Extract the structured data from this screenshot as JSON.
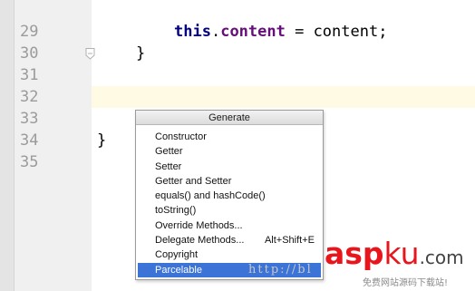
{
  "editor": {
    "line_numbers": [
      "29",
      "30",
      "31",
      "32",
      "33",
      "34",
      "35"
    ],
    "code_lines": [
      {
        "keyword": "this",
        "dot": ".",
        "field": "content",
        "rest": " = content;"
      },
      {
        "text": "}"
      },
      {
        "text": ""
      },
      {
        "text": ""
      },
      {
        "text": ""
      },
      {
        "text": "}"
      },
      {
        "text": ""
      }
    ],
    "current_line": "32"
  },
  "generate_popup": {
    "title": "Generate",
    "items": [
      {
        "label": "Constructor",
        "shortcut": ""
      },
      {
        "label": "Getter",
        "shortcut": ""
      },
      {
        "label": "Setter",
        "shortcut": ""
      },
      {
        "label": "Getter and Setter",
        "shortcut": ""
      },
      {
        "label": "equals() and hashCode()",
        "shortcut": ""
      },
      {
        "label": "toString()",
        "shortcut": ""
      },
      {
        "label": "Override Methods...",
        "shortcut": ""
      },
      {
        "label": "Delegate Methods...",
        "shortcut": "Alt+Shift+E"
      },
      {
        "label": "Copyright",
        "shortcut": ""
      },
      {
        "label": "Parcelable",
        "shortcut": ""
      }
    ],
    "selected_item": "Parcelable"
  },
  "watermark": {
    "url_text": "http://bl",
    "logo_asp": "asp",
    "logo_ku": "ku",
    "logo_tld": ".com",
    "caption": "免费网站源码下载站!"
  },
  "colors": {
    "keyword": "#000080",
    "field": "#660e7a",
    "selection": "#3b73d6",
    "current_line": "#fffae3",
    "logo_red": "#e8161c"
  }
}
